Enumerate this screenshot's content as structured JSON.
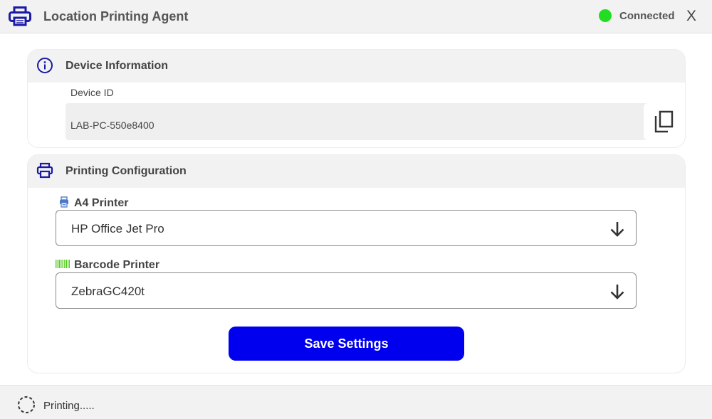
{
  "app": {
    "title": "Location Printing Agent",
    "icon": "printer-icon",
    "connection_status": "Connected",
    "connection_color": "#22dd22",
    "close_label": "X"
  },
  "device_info": {
    "header": "Device Information",
    "icon": "info-icon",
    "device_id_label": "Device ID",
    "device_id_value": "LAB-PC-550e8400",
    "copy_icon": "copy-icon"
  },
  "printing_config": {
    "header": "Printing Configuration",
    "icon": "printer-icon",
    "a4_printer": {
      "label": "A4 Printer",
      "icon": "printer-small-icon",
      "selected": "HP Office Jet Pro"
    },
    "barcode_printer": {
      "label": "Barcode Printer",
      "icon": "barcode-icon",
      "selected": "ZebraGC420t"
    },
    "save_label": "Save Settings",
    "accent_color": "#0000ee"
  },
  "status_bar": {
    "message": "Printing.....",
    "icon": "spinner-icon"
  }
}
